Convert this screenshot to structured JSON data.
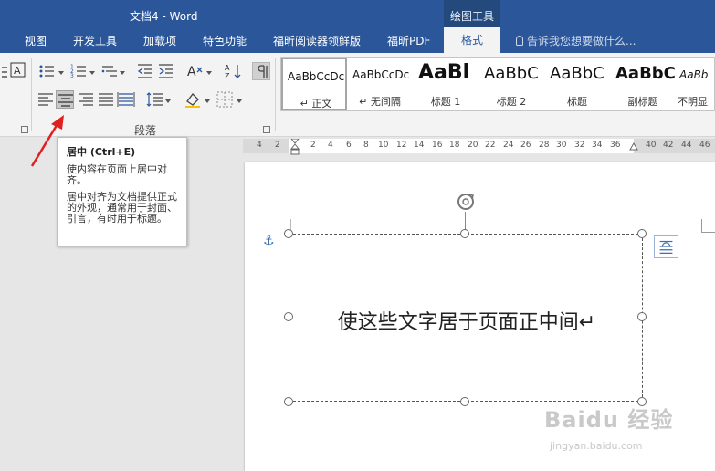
{
  "titlebar": {
    "doc_title": "文档4 - Word",
    "tools_group": "绘图工具",
    "tabs": [
      "视图",
      "开发工具",
      "加载项",
      "特色功能",
      "福昕阅读器领鲜版",
      "福昕PDF",
      "格式"
    ],
    "tell_me": "告诉我您想要做什么..."
  },
  "ribbon": {
    "group_label": "段落",
    "styles": [
      {
        "sample": "AaBbCcDc",
        "name": "↵ 正文"
      },
      {
        "sample": "AaBbCcDc",
        "name": "↵ 无间隔"
      },
      {
        "sample": "AaBl",
        "name": "标题 1"
      },
      {
        "sample": "AaBbC",
        "name": "标题 2"
      },
      {
        "sample": "AaBbC",
        "name": "标题"
      },
      {
        "sample": "AaBbC",
        "name": "副标题"
      },
      {
        "sample": "AaBb",
        "name": "不明显"
      }
    ]
  },
  "ruler": {
    "ticks": [
      "4",
      "2",
      "2",
      "4",
      "6",
      "8",
      "10",
      "12",
      "14",
      "16",
      "18",
      "20",
      "22",
      "24",
      "26",
      "28",
      "30",
      "32",
      "34",
      "36",
      "40",
      "42",
      "44",
      "46"
    ]
  },
  "document": {
    "textbox_text": "使这些文字居于页面正中间↵"
  },
  "tooltip": {
    "title": "居中 (Ctrl+E)",
    "p1": "使内容在页面上居中对齐。",
    "p2": "居中对齐为文档提供正式的外观，通常用于封面、引言，有时用于标题。"
  },
  "watermark": {
    "logo": "Baidu 经验",
    "url": "jingyan.baidu.com"
  },
  "colors": {
    "title_bar": "#2b579a",
    "ribbon_bg": "#f3f3f3",
    "arrow": "#e02020"
  }
}
